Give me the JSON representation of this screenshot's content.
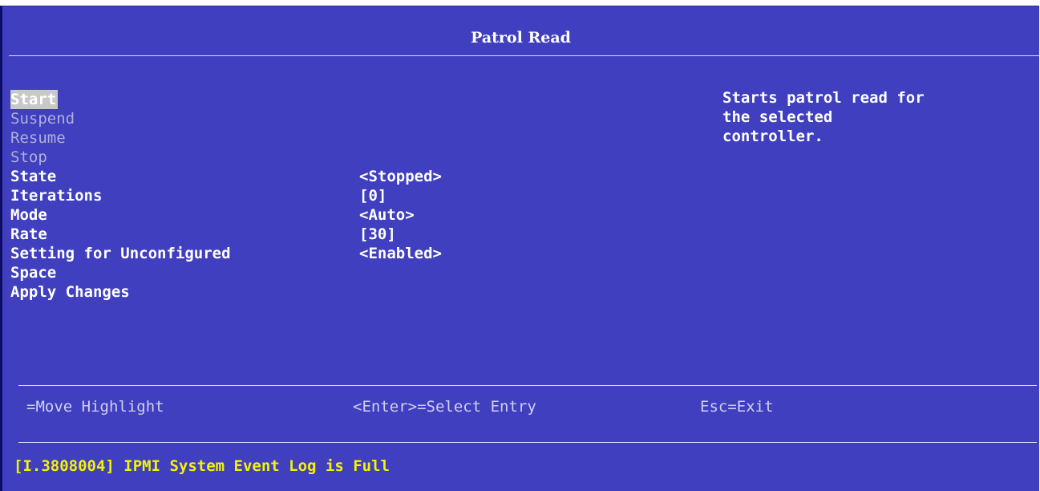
{
  "header": {
    "title": "Patrol Read"
  },
  "menu": {
    "items": [
      {
        "label": "Start",
        "state": "highlight"
      },
      {
        "label": "Suspend",
        "state": "disabled"
      },
      {
        "label": "Resume",
        "state": "disabled"
      },
      {
        "label": "Stop",
        "state": "disabled"
      },
      {
        "label": "State",
        "state": "normal"
      },
      {
        "label": "Iterations",
        "state": "normal"
      },
      {
        "label": "Mode",
        "state": "normal"
      },
      {
        "label": "Rate",
        "state": "normal"
      },
      {
        "label": "Setting for Unconfigured",
        "state": "normal"
      },
      {
        "label": "Space",
        "state": "normal"
      },
      {
        "label": "Apply Changes",
        "state": "normal"
      }
    ]
  },
  "values": {
    "state": "<Stopped>",
    "iterations": "[0]",
    "mode": "<Auto>",
    "rate": "[30]",
    "setting_for_unconfigured": "<Enabled>"
  },
  "help": {
    "text": "Starts patrol read for\nthe selected\ncontroller."
  },
  "footer": {
    "move": "=Move Highlight",
    "select": "<Enter>=Select Entry",
    "exit": "Esc=Exit"
  },
  "status": {
    "message": "[I.3808004] IPMI System Event Log is Full",
    "color": "#f4f400"
  },
  "colors": {
    "background": "#3f3fbf",
    "highlight": "#c8c8c8",
    "disabled_text": "#b0b0d8"
  }
}
